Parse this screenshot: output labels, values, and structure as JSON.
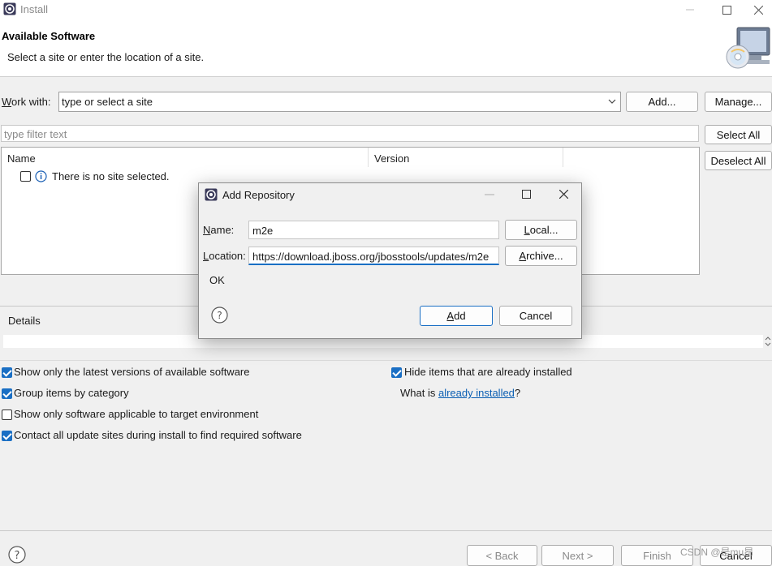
{
  "window": {
    "title": "Install"
  },
  "header": {
    "title": "Available Software",
    "subtitle": "Select a site or enter the location of a site."
  },
  "work_with": {
    "label": "Work with:",
    "value": "type or select a site",
    "add_label": "Add...",
    "manage_label": "Manage..."
  },
  "filter": {
    "placeholder": "type filter text"
  },
  "buttons": {
    "select_all": "Select All",
    "deselect_all": "Deselect All"
  },
  "tree": {
    "columns": [
      "Name",
      "Version"
    ],
    "rows": [
      {
        "label": "There is no site selected.",
        "checked": false
      }
    ]
  },
  "details": {
    "label": "Details"
  },
  "options": [
    {
      "label": "Show only the latest versions of available software",
      "checked": true
    },
    {
      "label": "Group items by category",
      "checked": true
    },
    {
      "label": "Show only software applicable to target environment",
      "checked": false
    },
    {
      "label": "Contact all update sites during install to find required software",
      "checked": true
    },
    {
      "label": "Hide items that are already installed",
      "checked": true
    }
  ],
  "what_is": {
    "prefix": "What is ",
    "link": "already installed",
    "suffix": "?"
  },
  "footer": {
    "back": "< Back",
    "next": "Next >",
    "finish": "Finish",
    "cancel": "Cancel",
    "watermark": "CSDN @是mu昂"
  },
  "dialog": {
    "title": "Add Repository",
    "name_label": "Name:",
    "name_value": "m2e",
    "location_label": "Location:",
    "location_value": "https://download.jboss.org/jbosstools/updates/m2e",
    "local_label": "Local...",
    "archive_label": "Archive...",
    "status": "OK",
    "add_label": "Add",
    "cancel_label": "Cancel"
  }
}
